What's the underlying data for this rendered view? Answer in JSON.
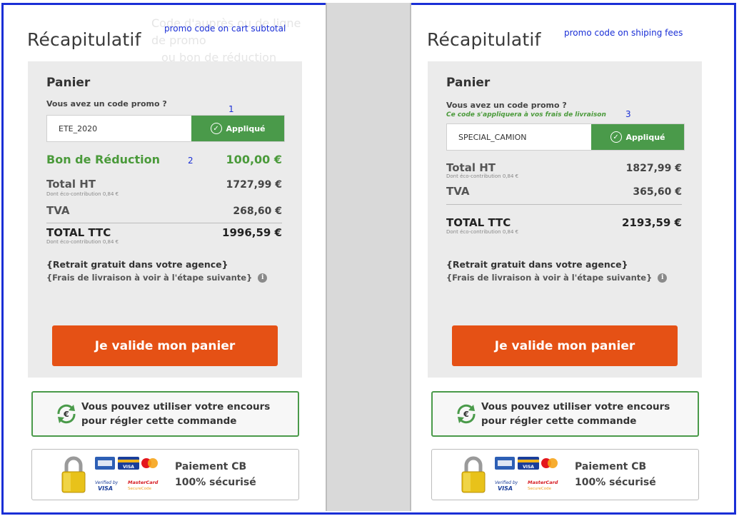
{
  "left": {
    "title": "Récapitulatif",
    "annotation": "promo code on cart subtotal",
    "ghost_text_1": "Code d'auprès ou de ligne de promo",
    "ghost_text_2": "ou bon de réduction",
    "panel_title": "Panier",
    "promo_question": "Vous avez un code promo ?",
    "marker_1": "1",
    "promo_value": "ETE_2020",
    "promo_button": "Appliqué",
    "discount_label": "Bon de Réduction",
    "marker_2": "2",
    "discount_value": "100,00 €",
    "total_ht_label": "Total HT",
    "total_ht_sub": "Dont éco-contribution 0,84 €",
    "total_ht_value": "1727,99 €",
    "tva_label": "TVA",
    "tva_value": "268,60 €",
    "total_ttc_label": "TOTAL TTC",
    "total_ttc_sub": "Dont éco-contribution 0,84 €",
    "total_ttc_value": "1996,59 €",
    "retrait": "{Retrait gratuit dans votre agence}",
    "frais": "{Frais de livraison à voir à l'étape suivante}",
    "validate": "Je valide mon panier",
    "encours_1": "Vous pouvez utiliser votre encours",
    "encours_2": "pour régler cette commande",
    "pay_1": "Paiement CB",
    "pay_2": "100% sécurisé"
  },
  "right": {
    "title": "Récapitulatif",
    "annotation": "promo code on shiping fees",
    "panel_title": "Panier",
    "promo_question": "Vous avez un code promo ?",
    "promo_note": "Ce code s'appliquera à vos frais de livraison",
    "marker_3": "3",
    "promo_value": "SPECIAL_CAMION",
    "promo_button": "Appliqué",
    "total_ht_label": "Total HT",
    "total_ht_sub": "Dont éco-contribution 0,84 €",
    "total_ht_value": "1827,99 €",
    "tva_label": "TVA",
    "tva_value": "365,60 €",
    "total_ttc_label": "TOTAL TTC",
    "total_ttc_sub": "Dont éco-contribution 0,84 €",
    "total_ttc_value": "2193,59 €",
    "retrait": "{Retrait gratuit dans votre agence}",
    "frais": "{Frais de livraison à voir à l'étape suivante}",
    "validate": "Je valide mon panier",
    "encours_1": "Vous pouvez utiliser votre encours",
    "encours_2": "pour régler cette commande",
    "pay_1": "Paiement CB",
    "pay_2": "100% sécurisé"
  },
  "card_logos": {
    "visa_small": "VISA",
    "verified_by": "Verified by",
    "verified_visa": "VISA",
    "mastercard": "MasterCard",
    "securecode": "SecureCode"
  },
  "colors": {
    "frame": "#1a2fd6",
    "accent_orange": "#e55115",
    "green": "#4a9a4a",
    "panel_bg": "#ebebeb"
  }
}
